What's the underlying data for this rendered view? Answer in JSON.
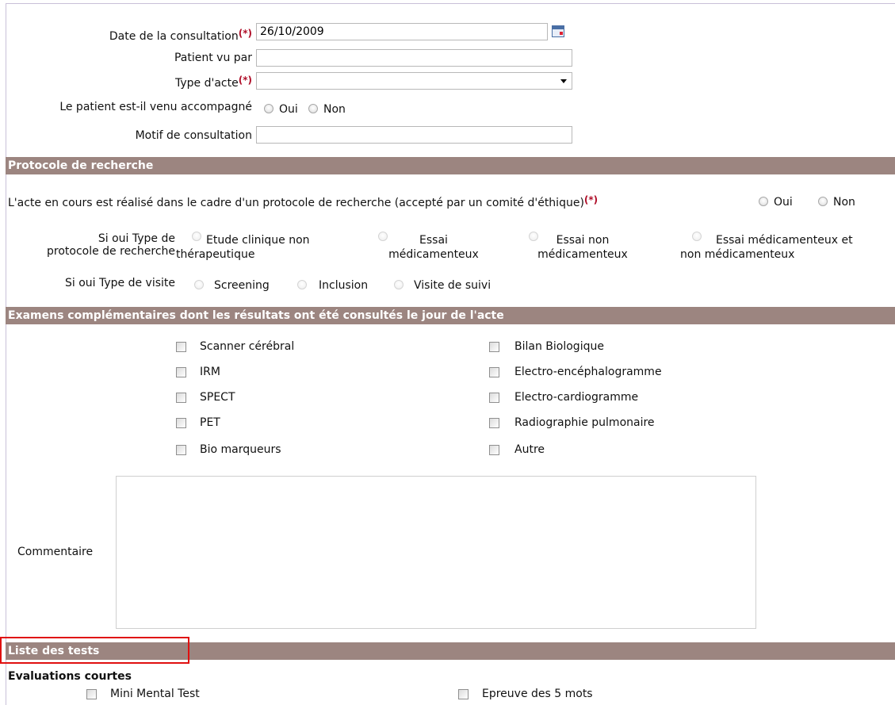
{
  "consultation": {
    "date_label": "Date de la consultation",
    "required_mark": "(*)",
    "date_value": "26/10/2009",
    "patient_seen_by_label": "Patient vu par",
    "act_type_label": "Type d'acte",
    "accompanied_label": "Le patient est-il venu accompagné",
    "yes": "Oui",
    "no": "Non",
    "reason_label": "Motif de consultation"
  },
  "research": {
    "header": "Protocole de recherche",
    "question": "L'acte en cours est réalisé dans le cadre d'un protocole de recherche (accepté par un comité d'éthique)",
    "yes": "Oui",
    "no": "Non",
    "protocol_type_label_1": "Si oui Type de",
    "protocol_type_label_2": "protocole de recherche",
    "protocol_options": [
      {
        "line1": "Etude clinique non",
        "line2": "thérapeutique"
      },
      {
        "line1": "Essai",
        "line2": "médicamenteux"
      },
      {
        "line1": "Essai non",
        "line2": "médicamenteux"
      },
      {
        "line1": "Essai médicamenteux et",
        "line2": "non médicamenteux"
      }
    ],
    "visit_type_label": "Si oui Type de visite",
    "visit_options": [
      "Screening",
      "Inclusion",
      "Visite de suivi"
    ]
  },
  "exams": {
    "header": "Examens complémentaires dont les résultats ont été consultés le jour de l'acte",
    "left": [
      "Scanner cérébral",
      "IRM",
      "SPECT",
      "PET",
      "Bio marqueurs"
    ],
    "right": [
      "Bilan Biologique",
      "Electro-encéphalogramme",
      "Electro-cardiogramme",
      "Radiographie pulmonaire",
      "Autre"
    ],
    "comment_label": "Commentaire"
  },
  "tests": {
    "header": "Liste des tests",
    "short_evals_label": "Evaluations courtes",
    "items": [
      "Mini Mental Test",
      "Epreuve des 5 mots"
    ]
  },
  "colors": {
    "section_bar": "#9c8580",
    "required": "#b0102a",
    "highlight_box": "#e01010"
  }
}
